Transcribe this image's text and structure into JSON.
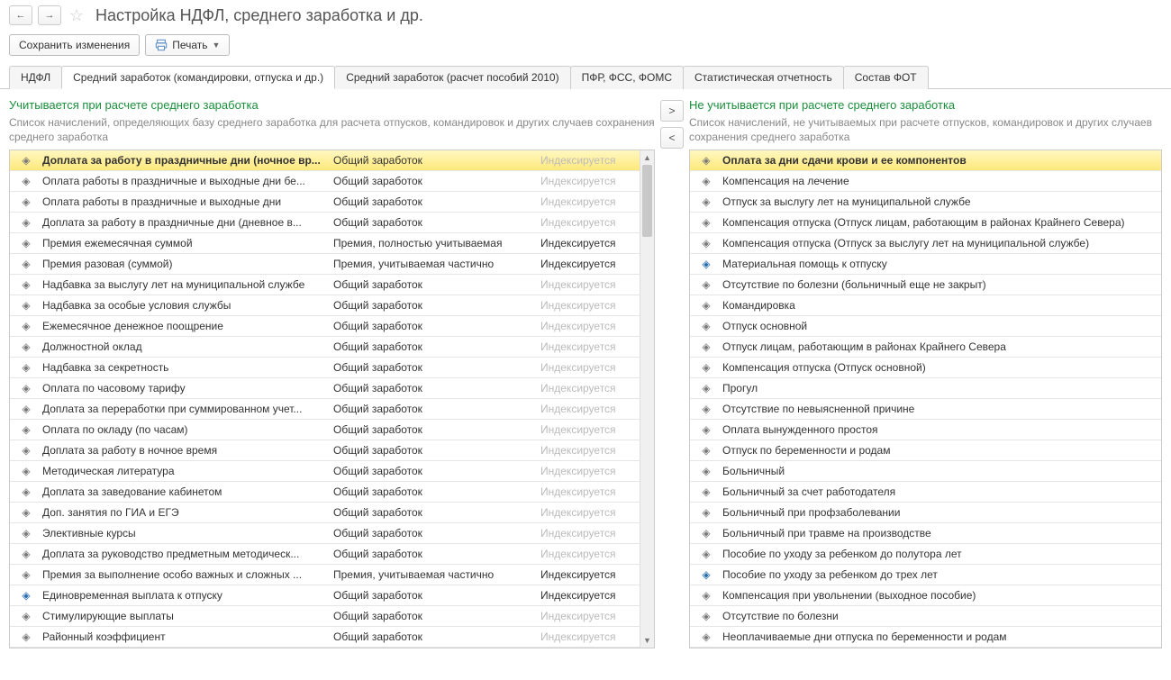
{
  "header": {
    "title": "Настройка НДФЛ, среднего заработка и др."
  },
  "toolbar": {
    "save_label": "Сохранить изменения",
    "print_label": "Печать"
  },
  "tabs": [
    {
      "label": "НДФЛ"
    },
    {
      "label": "Средний заработок (командировки, отпуска и др.)"
    },
    {
      "label": "Средний заработок (расчет пособий 2010)"
    },
    {
      "label": "ПФР, ФСС, ФОМС"
    },
    {
      "label": "Статистическая отчетность"
    },
    {
      "label": "Состав ФОТ"
    }
  ],
  "active_tab": 1,
  "left": {
    "title": "Учитывается при расчете среднего заработка",
    "desc": "Список начислений, определяющих базу среднего заработка для расчета отпусков, командировок и других случаев сохранения среднего заработка",
    "rows": [
      {
        "name": "Доплата за работу в праздничные дни (ночное вр...",
        "type": "Общий заработок",
        "index": "dim",
        "blue": false,
        "selected": true
      },
      {
        "name": "Оплата работы в праздничные и выходные дни бе...",
        "type": "Общий заработок",
        "index": "dim",
        "blue": false
      },
      {
        "name": "Оплата работы в праздничные и выходные дни",
        "type": "Общий заработок",
        "index": "dim",
        "blue": false
      },
      {
        "name": "Доплата за работу в праздничные дни (дневное в...",
        "type": "Общий заработок",
        "index": "dim",
        "blue": false
      },
      {
        "name": "Премия ежемесячная суммой",
        "type": "Премия, полностью учитываемая",
        "index": "norm",
        "blue": false
      },
      {
        "name": "Премия разовая (суммой)",
        "type": "Премия, учитываемая частично",
        "index": "norm",
        "blue": false
      },
      {
        "name": "Надбавка за выслугу лет на муниципальной службе",
        "type": "Общий заработок",
        "index": "dim",
        "blue": false
      },
      {
        "name": "Надбавка за особые условия службы",
        "type": "Общий заработок",
        "index": "dim",
        "blue": false
      },
      {
        "name": "Ежемесячное денежное поощрение",
        "type": "Общий заработок",
        "index": "dim",
        "blue": false
      },
      {
        "name": "Должностной оклад",
        "type": "Общий заработок",
        "index": "dim",
        "blue": false
      },
      {
        "name": "Надбавка за секретность",
        "type": "Общий заработок",
        "index": "dim",
        "blue": false
      },
      {
        "name": "Оплата по часовому тарифу",
        "type": "Общий заработок",
        "index": "dim",
        "blue": false
      },
      {
        "name": "Доплата за переработки при суммированном учет...",
        "type": "Общий заработок",
        "index": "dim",
        "blue": false
      },
      {
        "name": "Оплата по окладу (по часам)",
        "type": "Общий заработок",
        "index": "dim",
        "blue": false
      },
      {
        "name": "Доплата за работу в ночное время",
        "type": "Общий заработок",
        "index": "dim",
        "blue": false
      },
      {
        "name": "Методическая литература",
        "type": "Общий заработок",
        "index": "dim",
        "blue": false
      },
      {
        "name": "Доплата за заведование кабинетом",
        "type": "Общий заработок",
        "index": "dim",
        "blue": false
      },
      {
        "name": "Доп. занятия по ГИА и ЕГЭ",
        "type": "Общий заработок",
        "index": "dim",
        "blue": false
      },
      {
        "name": "Элективные курсы",
        "type": "Общий заработок",
        "index": "dim",
        "blue": false
      },
      {
        "name": "Доплата за руководство предметным методическ...",
        "type": "Общий заработок",
        "index": "dim",
        "blue": false
      },
      {
        "name": "Премия за выполнение особо важных и сложных ...",
        "type": "Премия, учитываемая частично",
        "index": "norm",
        "blue": false
      },
      {
        "name": "Единовременная выплата к отпуску",
        "type": "Общий заработок",
        "index": "norm",
        "blue": true
      },
      {
        "name": "Стимулирующие выплаты",
        "type": "Общий заработок",
        "index": "dim",
        "blue": false
      },
      {
        "name": "Районный коэффициент",
        "type": "Общий заработок",
        "index": "dim",
        "blue": false
      }
    ],
    "index_label": "Индексируется"
  },
  "right": {
    "title": "Не учитывается при расчете среднего заработка",
    "desc": "Список начислений, не учитываемых при расчете отпусков, командировок и других случаев сохранения среднего заработка",
    "rows": [
      {
        "name": "Оплата за дни сдачи крови и ее компонентов",
        "blue": false,
        "selected": true
      },
      {
        "name": "Компенсация на лечение",
        "blue": false
      },
      {
        "name": "Отпуск за выслугу лет на муниципальной службе",
        "blue": false
      },
      {
        "name": "Компенсация отпуска (Отпуск лицам, работающим в районах Крайнего Севера)",
        "blue": false
      },
      {
        "name": "Компенсация отпуска (Отпуск за выслугу лет на муниципальной службе)",
        "blue": false
      },
      {
        "name": "Материальная помощь к отпуску",
        "blue": true
      },
      {
        "name": "Отсутствие по болезни (больничный еще не закрыт)",
        "blue": false
      },
      {
        "name": "Командировка",
        "blue": false
      },
      {
        "name": "Отпуск основной",
        "blue": false
      },
      {
        "name": "Отпуск лицам, работающим в районах Крайнего Севера",
        "blue": false
      },
      {
        "name": "Компенсация отпуска (Отпуск основной)",
        "blue": false
      },
      {
        "name": "Прогул",
        "blue": false
      },
      {
        "name": "Отсутствие по невыясненной причине",
        "blue": false
      },
      {
        "name": "Оплата вынужденного простоя",
        "blue": false
      },
      {
        "name": "Отпуск по беременности и родам",
        "blue": false
      },
      {
        "name": "Больничный",
        "blue": false
      },
      {
        "name": "Больничный за счет работодателя",
        "blue": false
      },
      {
        "name": "Больничный при профзаболевании",
        "blue": false
      },
      {
        "name": "Больничный при травме на производстве",
        "blue": false
      },
      {
        "name": "Пособие по уходу за ребенком до полутора лет",
        "blue": false
      },
      {
        "name": "Пособие по уходу за ребенком до трех лет",
        "blue": true
      },
      {
        "name": "Компенсация при увольнении (выходное пособие)",
        "blue": false
      },
      {
        "name": "Отсутствие по болезни",
        "blue": false
      },
      {
        "name": "Неоплачиваемые дни отпуска по беременности и родам",
        "blue": false
      }
    ]
  },
  "move": {
    "right": ">",
    "left": "<"
  }
}
